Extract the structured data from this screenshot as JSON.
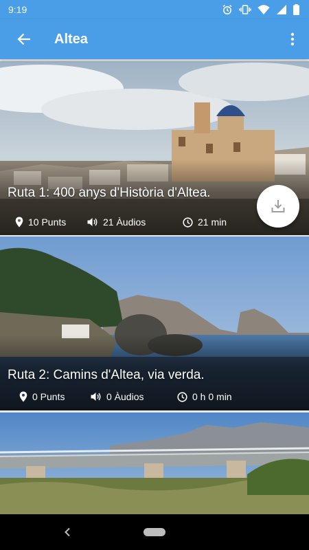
{
  "status_bar": {
    "time": "9:19",
    "icons": [
      "alarm-icon",
      "vibrate-icon",
      "wifi-icon",
      "signal-icon",
      "battery-icon"
    ]
  },
  "app_bar": {
    "title": "Altea",
    "back_icon": "arrow-left-icon",
    "menu_icon": "more-vert-icon",
    "background_color": "#4a9ee8"
  },
  "routes": [
    {
      "title": "Ruta 1: 400 anys d'Història d'Altea.",
      "points": "10 Punts",
      "audios": "21 Àudios",
      "duration": "21 min",
      "has_download": true
    },
    {
      "title": "Ruta 2: Camins d'Altea, via verda.",
      "points": "0 Punts",
      "audios": "0 Àudios",
      "duration": "0 h 0 min",
      "has_download": false
    },
    {
      "title": "",
      "points": "",
      "audios": "",
      "duration": "",
      "has_download": false
    }
  ],
  "nav_bar": {
    "back_icon": "nav-back-chevron-icon",
    "home_icon": "nav-home-pill-icon"
  }
}
